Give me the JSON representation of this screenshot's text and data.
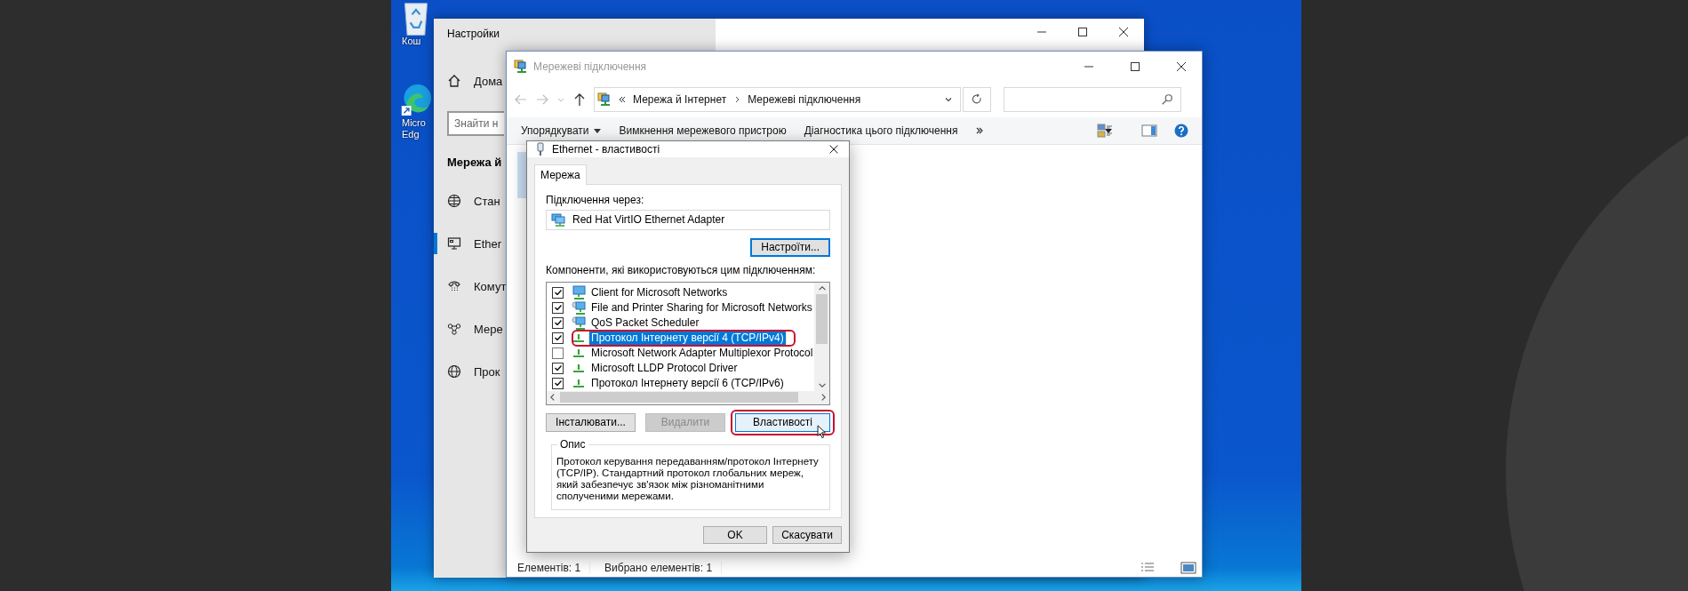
{
  "desktop": {
    "icons": [
      {
        "kind": "recycle_bin",
        "lines": [
          "Кош"
        ]
      },
      {
        "kind": "edge",
        "lines": [
          "Micro",
          "Edg"
        ]
      }
    ]
  },
  "settings_window": {
    "title": "Настройки",
    "home": "Дома",
    "search": {
      "placeholder": "Знайти н"
    },
    "heading": "Мережа й",
    "nav_items": [
      {
        "kind": "status",
        "label": "Стан",
        "selected": false
      },
      {
        "kind": "ethernet",
        "label": "Ether",
        "selected": true
      },
      {
        "kind": "dialup",
        "label": "Комут",
        "selected": false
      },
      {
        "kind": "vpn",
        "label": "Мере",
        "selected": false
      },
      {
        "kind": "proxy",
        "label": "Прок",
        "selected": false
      }
    ]
  },
  "network_window": {
    "title": "Мережеві підключення",
    "address": {
      "crumbs": [
        "Мережа й Інтернет",
        "Мережеві підключення"
      ]
    },
    "toolbar": [
      {
        "label": "Упорядкувати",
        "dropdown": true
      },
      {
        "label": "Вимкнення мережевого пристрою",
        "dropdown": false
      },
      {
        "label": "Діагностика цього підключення",
        "dropdown": false
      }
    ],
    "status_bar": [
      "Елементів: 1",
      "Вибрано елементів: 1"
    ]
  },
  "dialog": {
    "title": "Ethernet - властивості",
    "tabs": [
      {
        "label": "Мережа",
        "selected": true
      }
    ],
    "connect_using_label": "Підключення через:",
    "adapter": "Red Hat VirtIO Ethernet Adapter",
    "configure_button": "Настроїти...",
    "components_label": "Компоненти, які використовуються цим підключенням:",
    "components": [
      {
        "kind": "client",
        "label": "Client for Microsoft Networks",
        "checked": true,
        "selected": false,
        "annotated": false
      },
      {
        "kind": "service",
        "label": "File and Printer Sharing for Microsoft Networks",
        "checked": true,
        "selected": false,
        "annotated": false
      },
      {
        "kind": "service",
        "label": "QoS Packet Scheduler",
        "checked": true,
        "selected": false,
        "annotated": false
      },
      {
        "kind": "protocol",
        "label": "Протокол Інтернету версії 4 (TCP/IPv4)",
        "checked": true,
        "selected": true,
        "annotated": true
      },
      {
        "kind": "protocol",
        "label": "Microsoft Network Adapter Multiplexor Protocol",
        "checked": false,
        "selected": false,
        "annotated": false
      },
      {
        "kind": "protocol",
        "label": "Microsoft LLDP Protocol Driver",
        "checked": true,
        "selected": false,
        "annotated": false
      },
      {
        "kind": "protocol",
        "label": "Протокол Інтернету версії 6 (TCP/IPv6)",
        "checked": true,
        "selected": false,
        "annotated": false
      }
    ],
    "buttons": [
      {
        "label": "Інсталювати...",
        "disabled": false,
        "annotated": false
      },
      {
        "label": "Видалити",
        "disabled": true,
        "annotated": false
      },
      {
        "label": "Властивості",
        "disabled": false,
        "annotated": true
      }
    ],
    "description": {
      "title": "Опис",
      "text": "Протокол керування передаванням/протокол Інтернету (TCP/IP). Стандартний протокол глобальних мереж, який забезпечує зв'язок між різноманітними сполученими мережами."
    },
    "footer_buttons": [
      "OK",
      "Скасувати"
    ]
  }
}
